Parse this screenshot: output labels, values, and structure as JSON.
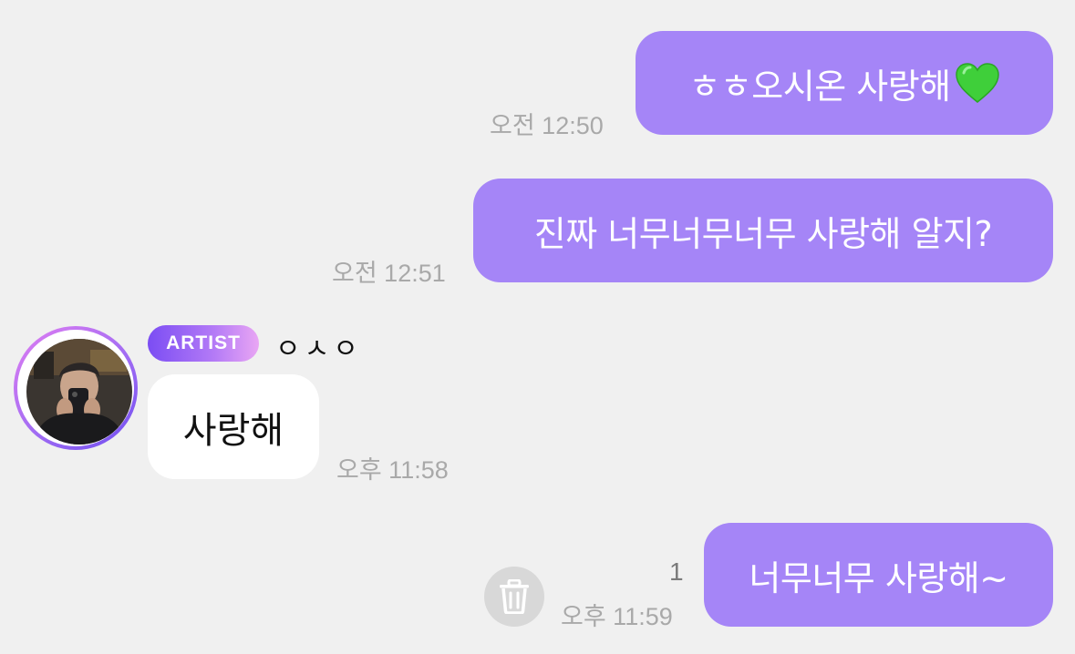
{
  "messages": [
    {
      "direction": "outgoing",
      "text": "ㅎㅎ오시온 사랑해",
      "emoji_icon": "green-heart-icon",
      "time": "오전 12:50"
    },
    {
      "direction": "outgoing",
      "text": "진짜 너무너무너무 사랑해 알지?",
      "time": "오전 12:51"
    },
    {
      "direction": "incoming",
      "sender": {
        "badge": "ARTIST",
        "name": "ㅇㅅㅇ",
        "avatar": "artist-avatar"
      },
      "text": "사랑해",
      "time": "오후 11:58"
    },
    {
      "direction": "outgoing",
      "text": "너무너무 사랑해~",
      "time": "오후 11:59",
      "unread_count": "1",
      "action_icon": "trash-icon"
    }
  ],
  "colors": {
    "outgoing_bubble": "#a585f7",
    "incoming_bubble": "#ffffff",
    "background": "#f0f0f0",
    "timestamp": "#a9a9a9",
    "badge_gradient_start": "#7b4df3",
    "badge_gradient_end": "#e9a6f4",
    "heart": "#3fcf3a"
  }
}
